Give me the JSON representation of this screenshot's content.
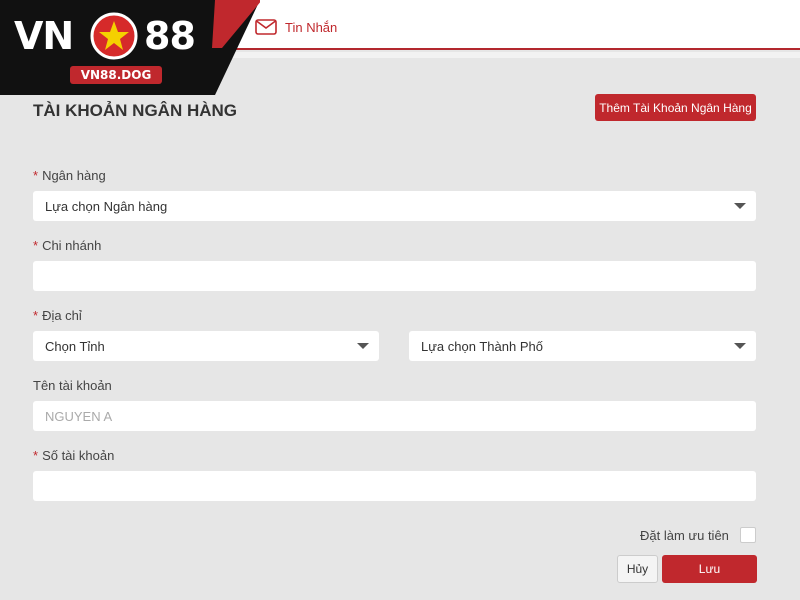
{
  "header": {
    "logo_vn": "VN",
    "logo_88": "88",
    "logo_domain": "VN88.DOG",
    "messages_tab_label": "Tin Nhắn",
    "messages_icon": "envelope-icon"
  },
  "page": {
    "title": "TÀI KHOẢN NGÂN HÀNG",
    "add_button_label": "Thêm Tài Khoản Ngân Hàng"
  },
  "form": {
    "bank": {
      "label": "Ngân hàng",
      "required_mark": "*",
      "value": "Lựa chọn Ngân hàng"
    },
    "branch": {
      "label": "Chi nhánh",
      "required_mark": "*",
      "value": ""
    },
    "address": {
      "label": "Địa chỉ",
      "required_mark": "*",
      "province_value": "Chọn Tỉnh",
      "city_value": "Lựa chọn Thành Phố"
    },
    "account_name": {
      "label": "Tên tài khoản",
      "placeholder": "NGUYEN A"
    },
    "account_number": {
      "label": "Số tài khoản",
      "required_mark": "*",
      "value": ""
    },
    "priority_label": "Đặt làm ưu tiên",
    "cancel_label": "Hủy",
    "save_label": "Lưu"
  },
  "colors": {
    "brand_red": "#c0282d",
    "background": "#e6e6e6",
    "logo_black": "#111111"
  }
}
